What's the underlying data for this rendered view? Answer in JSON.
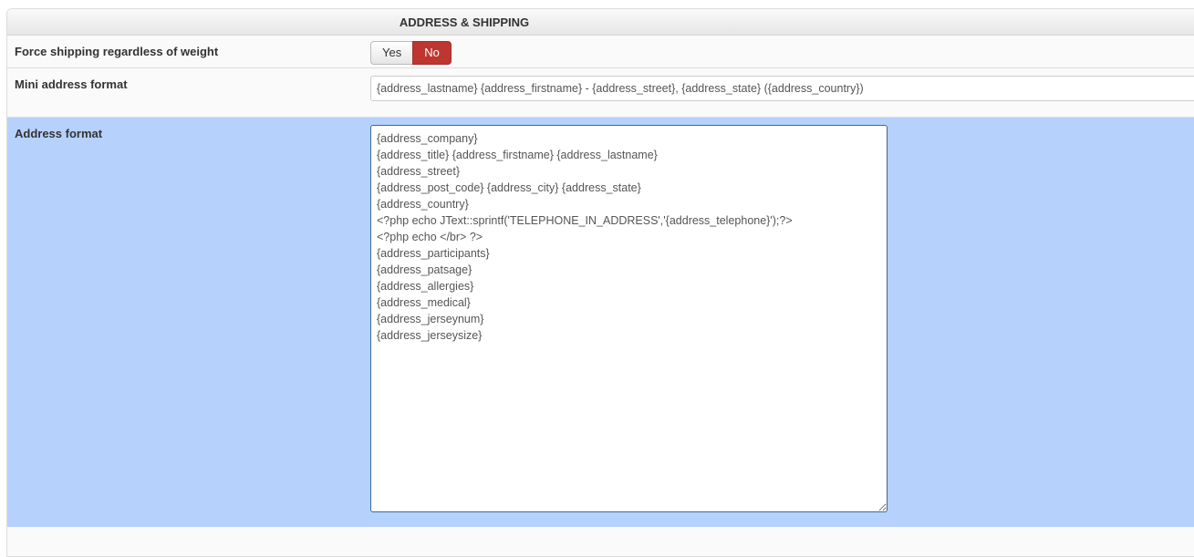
{
  "section": {
    "title": "ADDRESS & SHIPPING"
  },
  "force_shipping": {
    "label": "Force shipping regardless of weight",
    "yes_label": "Yes",
    "no_label": "No",
    "selected": "No",
    "selected_color": "#bd362f"
  },
  "mini_address": {
    "label": "Mini address format",
    "value": "{address_lastname} {address_firstname} - {address_street}, {address_state} ({address_country})"
  },
  "address_format": {
    "label": "Address format",
    "lines": [
      "{address_company}",
      "{address_title} {address_firstname} {address_lastname}",
      "{address_street}",
      "{address_post_code} {address_city} {address_state}",
      "{address_country}",
      "<?php echo JText::sprintf('TELEPHONE_IN_ADDRESS','{address_telephone}');?>",
      "<?php echo </br> ?>",
      "{address_participants}",
      "{address_patsage}",
      "{address_allergies}",
      "{address_medical}",
      "{address_jerseynum}",
      "{address_jerseysize}"
    ]
  }
}
